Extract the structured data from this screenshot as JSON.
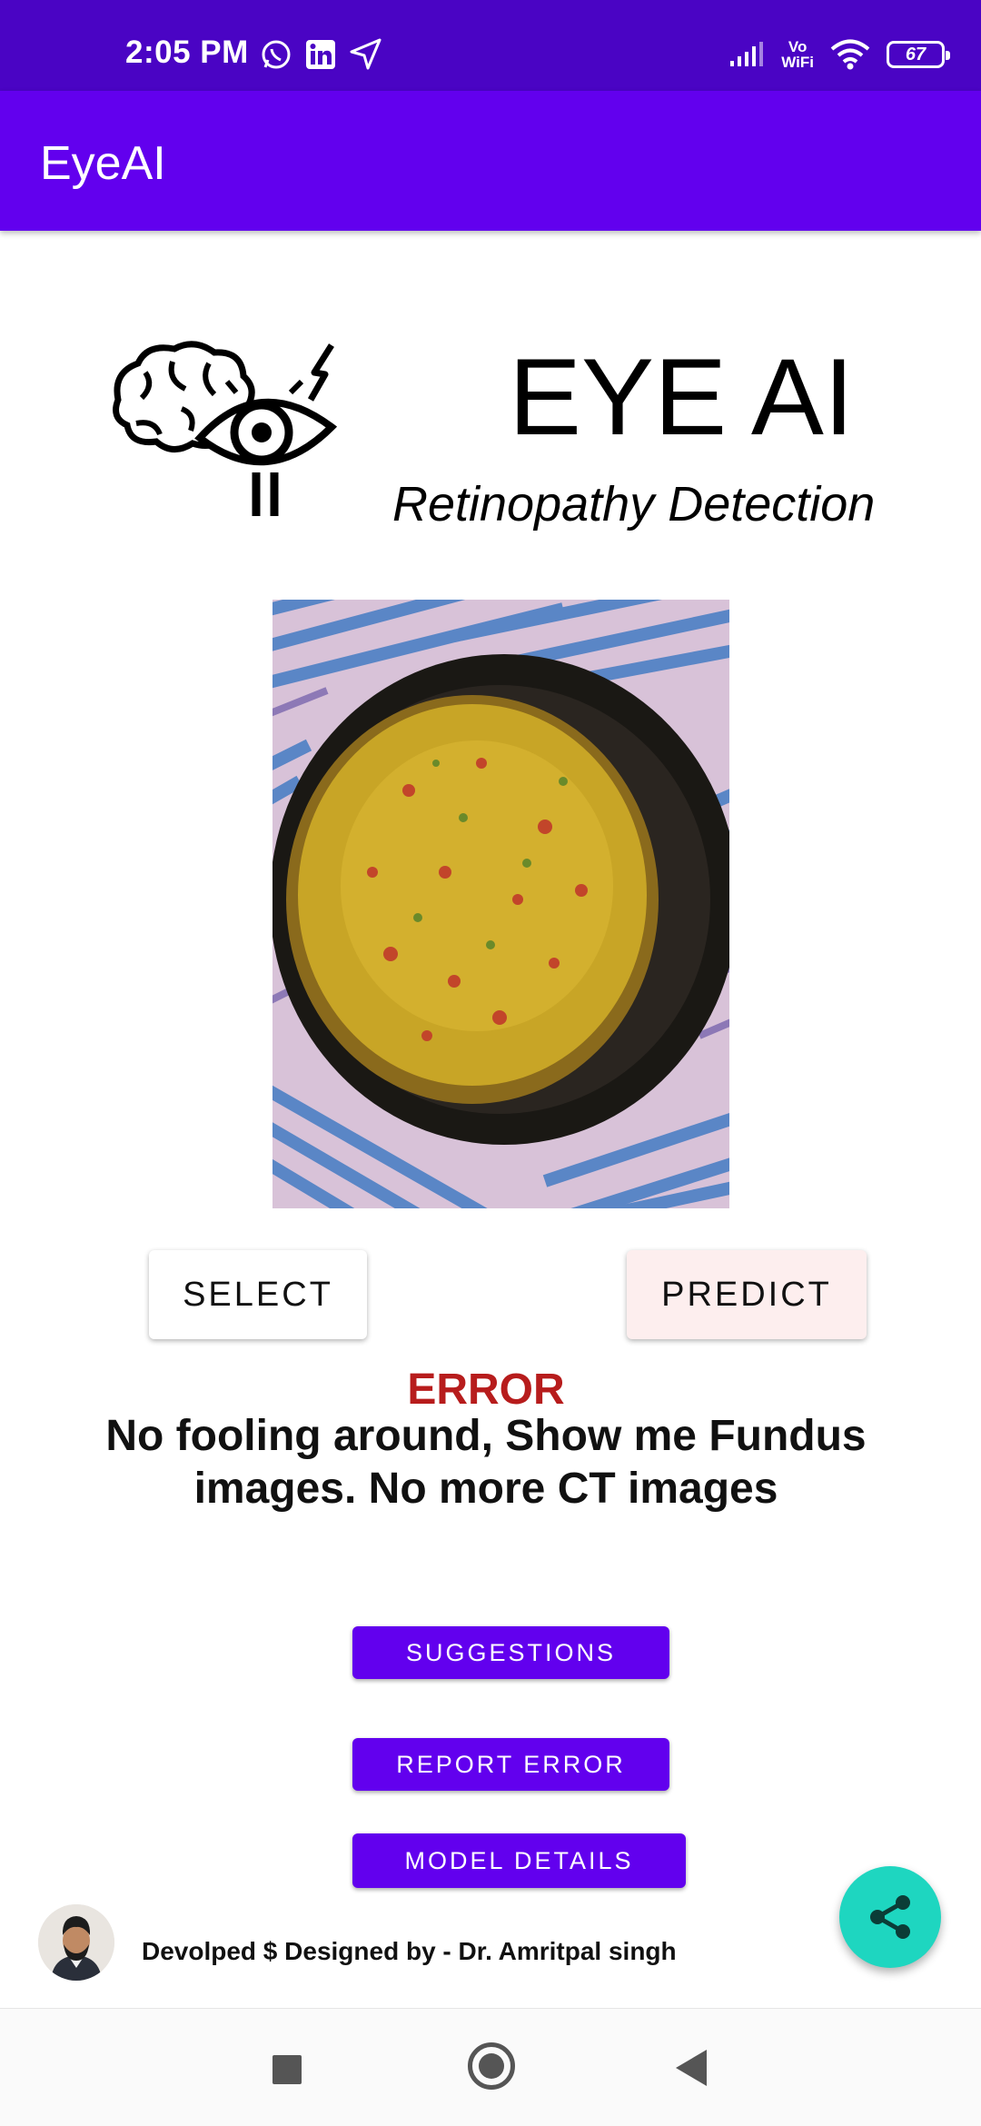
{
  "status_bar": {
    "time": "2:05 PM",
    "left_icons": [
      "whatsapp-icon",
      "linkedin-icon",
      "navigation-arrow-icon"
    ],
    "right_icons": [
      "signal-icon",
      "vowifi-icon",
      "wifi-icon",
      "battery-icon"
    ],
    "vowifi_top": "Vo",
    "vowifi_bottom": "WiFi",
    "battery_level": "67"
  },
  "app_bar": {
    "title": "EyeAI"
  },
  "header": {
    "logo_icon": "brain-eye-logo",
    "title": "EYE AI",
    "subtitle": "Retinopathy Detection"
  },
  "preview": {
    "image_icon": "food-bowl-photo"
  },
  "actions": {
    "select_label": "SELECT",
    "predict_label": "PREDICT"
  },
  "result": {
    "error_title": "ERROR",
    "error_message": "No fooling around, Show me Fundus images. No more CT images"
  },
  "links": {
    "suggestions_label": "SUGGESTIONS",
    "report_error_label": "REPORT ERROR",
    "model_details_label": "MODEL DETAILS"
  },
  "footer": {
    "credit": "Devolped $ Designed by - Dr. Amritpal singh",
    "avatar_icon": "developer-avatar"
  },
  "fab": {
    "icon": "share-icon"
  },
  "nav_bar": {
    "icons": [
      "recent-apps-icon",
      "home-icon",
      "back-icon"
    ]
  },
  "colors": {
    "status_bar": "#4a04c4",
    "app_bar": "#6200ee",
    "error": "#b71c1c",
    "fab": "#1ed6c0",
    "predict_bg": "#fdeeee"
  }
}
